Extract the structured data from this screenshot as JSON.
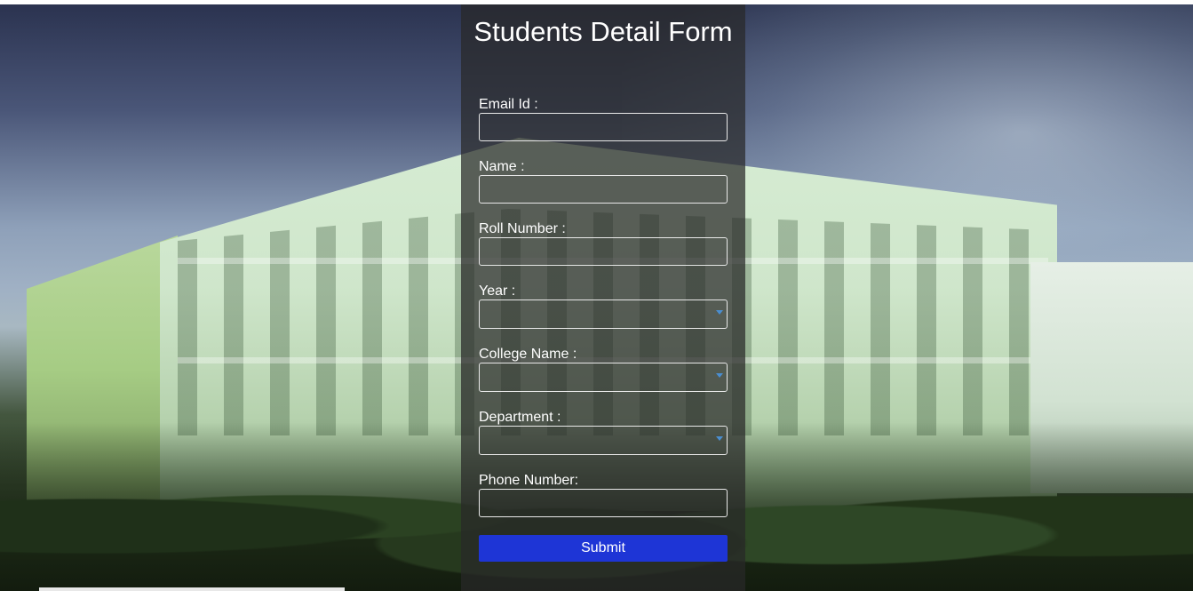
{
  "form": {
    "title": "Students Detail Form",
    "fields": [
      {
        "label": "Email Id :",
        "type": "text",
        "value": ""
      },
      {
        "label": "Name :",
        "type": "text",
        "value": ""
      },
      {
        "label": "Roll Number :",
        "type": "text",
        "value": ""
      },
      {
        "label": "Year :",
        "type": "select",
        "value": ""
      },
      {
        "label": "College Name :",
        "type": "select",
        "value": ""
      },
      {
        "label": "Department :",
        "type": "select",
        "value": ""
      },
      {
        "label": "Phone Number:",
        "type": "text",
        "value": ""
      }
    ],
    "submit_label": "Submit"
  },
  "colors": {
    "submit_button": "#1e35d6",
    "panel_background": "rgba(40,40,40,0.72)",
    "select_caret": "#4a8ed0"
  }
}
